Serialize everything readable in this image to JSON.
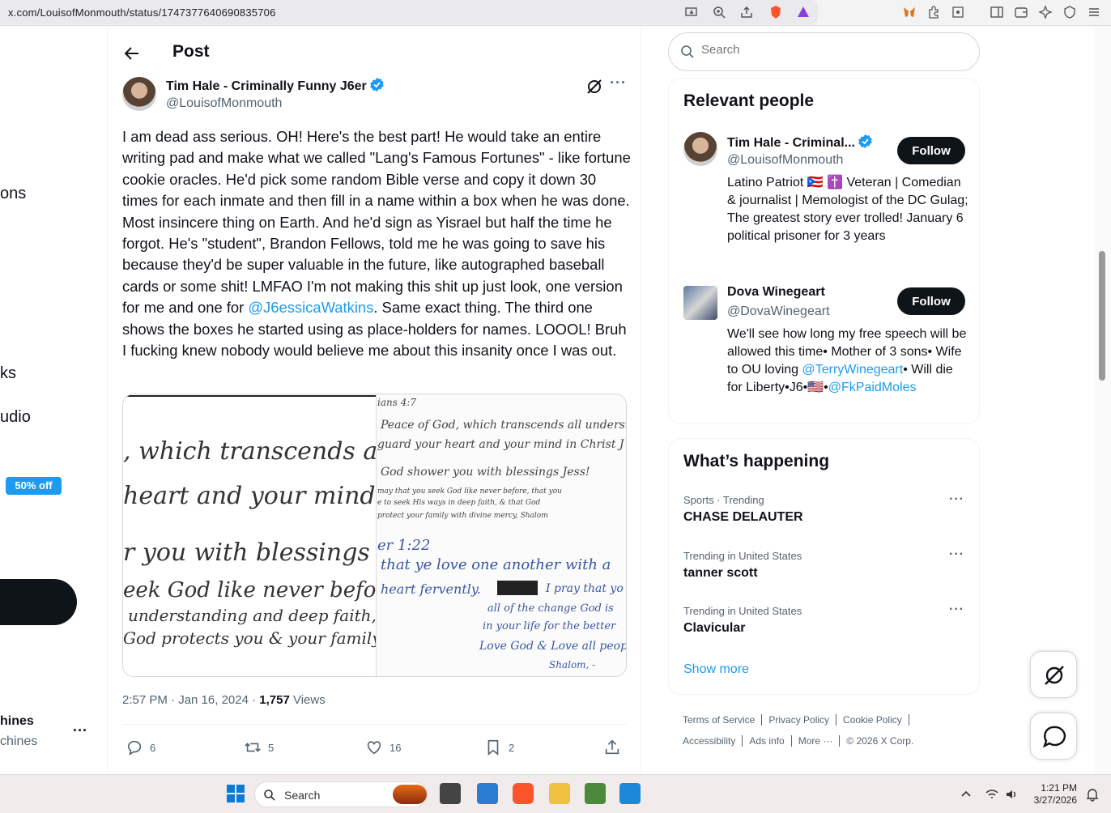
{
  "browser": {
    "url": "x.com/LouisofMonmouth/status/1747377640690835706"
  },
  "left_nav": {
    "fragments": [
      "ons",
      "ks",
      "udio"
    ],
    "promo_badge": "50% off",
    "account_name": "hines",
    "account_handle": "chines"
  },
  "post": {
    "header_title": "Post",
    "author_name": "Tim Hale - Criminally Funny J6er",
    "author_handle": "@LouisofMonmouth",
    "body_part1": "I am dead ass serious. OH! Here's the best part! He would take an entire writing pad and make what we called \"Lang's Famous Fortunes\" - like fortune cookie oracles. He'd pick some random Bible verse and copy it down 30 times for each inmate and then fill in a name within a box when he was done. Most insincere thing on Earth. And he'd sign as Yisrael but half the time he forgot. He's \"student\", Brandon Fellows, told me he was going to save his because they'd be super valuable in the future, like autographed baseball cards or some shit! LMFAO I'm not making this shit up just look, one version for me and one for ",
    "body_mention": "@J6essicaWatkins",
    "body_part2": ". Same exact thing. The third one shows the boxes he started using as place-holders for names. LOOOL! Bruh I fucking knew nobody would believe me about this insanity once I was out.",
    "image1_lines": [
      ", which transcends all",
      "heart and your mind",
      "r you with blessings T",
      "eek God like never before",
      "understanding and deep faith, &",
      "God protects you & your family,"
    ],
    "image2_lines": [
      "ians 4:7",
      "Peace of God, which transcends all understan",
      "guard your heart and your mind in Christ J",
      "God shower you with blessings Jess!",
      "may that you seek God like never before, that you",
      "e to seek His ways in deep faith, & that God",
      "protect your family with divine mercy, Shalom",
      "er 1:22",
      "that ye love one another with a",
      "heart fervently.",
      "I pray that yo",
      "all of the change God is",
      "in your life for the better",
      "Love God & Love all people",
      "Shalom, -"
    ],
    "time": "2:57 PM · Jan 16, 2024 · ",
    "views_count": "1,757",
    "views_label": " Views",
    "replies": "6",
    "reposts": "5",
    "likes": "16",
    "bookmarks": "2"
  },
  "right": {
    "search_placeholder": "Search",
    "relevant_title": "Relevant people",
    "people": [
      {
        "name": "Tim Hale - Criminal...",
        "handle": "@LouisofMonmouth",
        "bio": "Latino Patriot 🇵🇷 ✝️ Veteran | Comedian & journalist | Memologist of the DC Gulag; The greatest story ever trolled! January 6 political prisoner for 3 years",
        "follow": "Follow"
      },
      {
        "name": "Dova Winegeart",
        "handle": "@DovaWinegeart",
        "bio_a": "We'll see how long my free speech will be allowed this time• Mother of 3 sons• Wife to OU loving ",
        "bio_mention1": "@TerryWinegeart",
        "bio_b": "• Will die for Liberty•J6•🇺🇸•",
        "bio_mention2": "@FkPaidMoles",
        "follow": "Follow"
      }
    ],
    "happening_title": "What’s happening",
    "trends": [
      {
        "category": "Sports · Trending",
        "name": "CHASE DELAUTER"
      },
      {
        "category": "Trending in United States",
        "name": "tanner scott"
      },
      {
        "category": "Trending in United States",
        "name": "Clavicular"
      }
    ],
    "show_more": "Show more",
    "footer_row1": [
      "Terms of Service",
      "Privacy Policy",
      "Cookie Policy"
    ],
    "footer_row2": [
      "Accessibility",
      "Ads info",
      "More ···"
    ],
    "copyright": "© 2026 X Corp."
  },
  "taskbar": {
    "search_label": "Search",
    "time": "1:21 PM",
    "date": "3/27/2026"
  },
  "colors": {
    "accent": "#1d9bf0",
    "text": "#0f1419",
    "muted": "#536471"
  }
}
